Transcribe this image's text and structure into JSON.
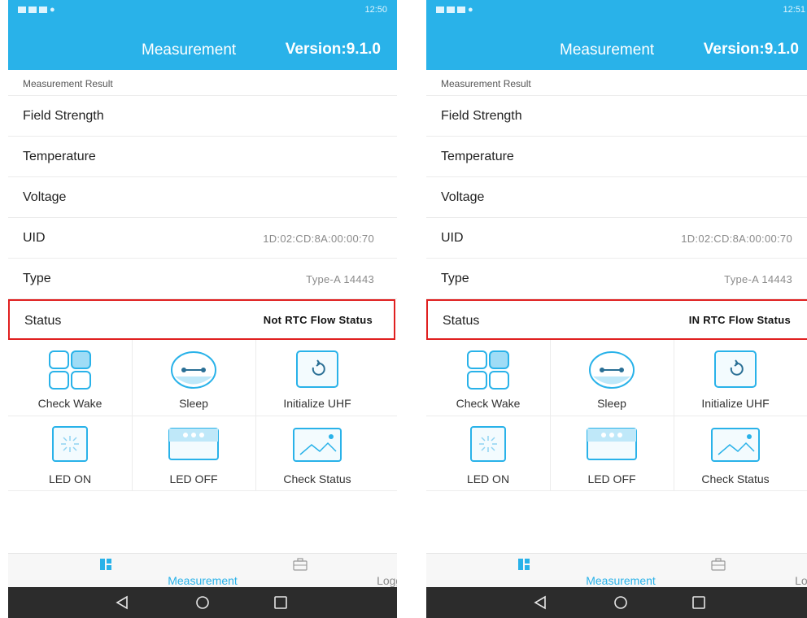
{
  "colors": {
    "accent": "#29b2e9",
    "highlight_border": "#e02020",
    "nav_bg": "#2c2c2c"
  },
  "screens": [
    {
      "status_bar": {
        "time": "12:50"
      },
      "header": {
        "title": "Measurement",
        "version": "Version:9.1.0"
      },
      "section_label": "Measurement Result",
      "rows": [
        {
          "label": "Field Strength",
          "value": ""
        },
        {
          "label": "Temperature",
          "value": ""
        },
        {
          "label": "Voltage",
          "value": ""
        },
        {
          "label": "UID",
          "value": "1D:02:CD:8A:00:00:70"
        },
        {
          "label": "Type",
          "value": "Type-A  14443"
        }
      ],
      "status_row": {
        "label": "Status",
        "value": "Not RTC Flow Status"
      },
      "actions": [
        {
          "label": "Check Wake",
          "icon": "grid-icon"
        },
        {
          "label": "Sleep",
          "icon": "sleep-icon"
        },
        {
          "label": "Initialize UHF",
          "icon": "refresh-icon"
        },
        {
          "label": "LED ON",
          "icon": "led-on-icon"
        },
        {
          "label": "LED OFF",
          "icon": "led-off-icon"
        },
        {
          "label": "Check Status",
          "icon": "image-icon"
        }
      ],
      "tabs": [
        {
          "label": "Measurement",
          "icon": "dashboard-icon",
          "active": true
        },
        {
          "label": "Logging",
          "icon": "briefcase-icon",
          "active": false
        }
      ]
    },
    {
      "status_bar": {
        "time": "12:51"
      },
      "header": {
        "title": "Measurement",
        "version": "Version:9.1.0"
      },
      "section_label": "Measurement Result",
      "rows": [
        {
          "label": "Field Strength",
          "value": ""
        },
        {
          "label": "Temperature",
          "value": ""
        },
        {
          "label": "Voltage",
          "value": ""
        },
        {
          "label": "UID",
          "value": "1D:02:CD:8A:00:00:70"
        },
        {
          "label": "Type",
          "value": "Type-A  14443"
        }
      ],
      "status_row": {
        "label": "Status",
        "value": "IN RTC Flow Status"
      },
      "actions": [
        {
          "label": "Check Wake",
          "icon": "grid-icon"
        },
        {
          "label": "Sleep",
          "icon": "sleep-icon"
        },
        {
          "label": "Initialize UHF",
          "icon": "refresh-icon"
        },
        {
          "label": "LED ON",
          "icon": "led-on-icon"
        },
        {
          "label": "LED OFF",
          "icon": "led-off-icon"
        },
        {
          "label": "Check Status",
          "icon": "image-icon"
        }
      ],
      "tabs": [
        {
          "label": "Measurement",
          "icon": "dashboard-icon",
          "active": true
        },
        {
          "label": "Logging",
          "icon": "briefcase-icon",
          "active": false
        }
      ]
    }
  ]
}
